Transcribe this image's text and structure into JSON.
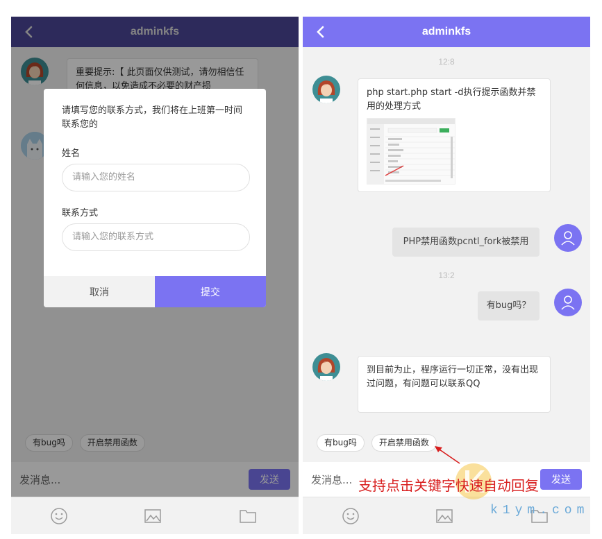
{
  "left_screen": {
    "header": {
      "title": "adminkfs"
    },
    "notice_bubble": "重要提示:【 此页面仅供测试，请勿相信任何信息，以免造成不必要的财产损",
    "tags": [
      "有bug吗",
      "开启禁用函数"
    ],
    "input": {
      "placeholder": "发消息...",
      "send_label": "发送"
    },
    "dialog": {
      "prompt": "请填写您的联系方式，我们将在上班第一时间联系您的",
      "name_label": "姓名",
      "name_placeholder": "请输入您的姓名",
      "contact_label": "联系方式",
      "contact_placeholder": "请输入您的联系方式",
      "cancel_label": "取消",
      "submit_label": "提交"
    }
  },
  "right_screen": {
    "header": {
      "title": "adminkfs"
    },
    "messages": [
      {
        "time": "12:8"
      },
      {
        "from": "agent",
        "text": "php start.php start -d执行提示函数并禁用的处理方式"
      },
      {
        "from": "user",
        "text": "PHP禁用函数pcntl_fork被禁用"
      },
      {
        "time": "13:2"
      },
      {
        "from": "user",
        "text": "有bug吗？"
      },
      {
        "from": "agent",
        "text": "到目前为止，程序运行一切正常，没有出现过问题，有问题可以联系QQ"
      }
    ],
    "tags": [
      "有bug吗",
      "开启禁用函数"
    ],
    "input": {
      "placeholder": "发消息...",
      "send_label": "发送"
    }
  },
  "annotation": "支持点击关键字快速自动回复",
  "watermark": {
    "text": "k1ym.com"
  },
  "colors": {
    "accent": "#7b73f2",
    "annotation": "#d81e1e"
  },
  "icons": [
    "back-chevron-icon",
    "emoji-icon",
    "image-icon",
    "folder-icon",
    "user-icon"
  ]
}
